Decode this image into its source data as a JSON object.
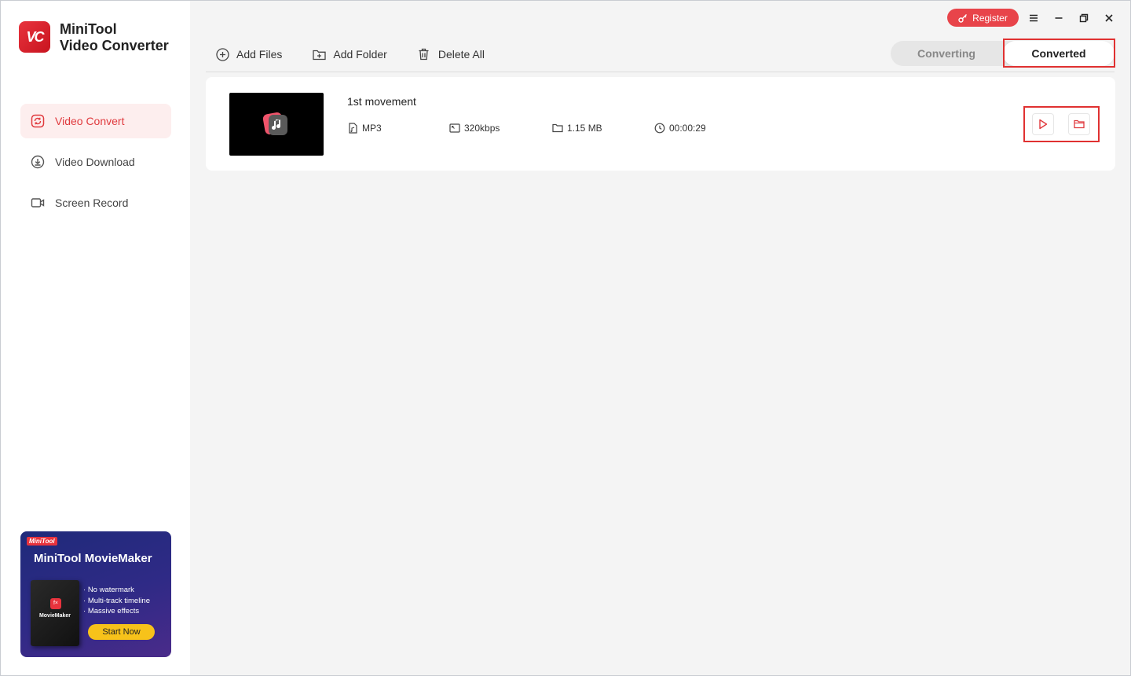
{
  "app": {
    "name_line1": "MiniTool",
    "name_line2": "Video Converter",
    "logo_text": "VC"
  },
  "sidebar": {
    "items": [
      {
        "label": "Video Convert",
        "icon": "convert-icon",
        "active": true
      },
      {
        "label": "Video Download",
        "icon": "download-icon",
        "active": false
      },
      {
        "label": "Screen Record",
        "icon": "camera-icon",
        "active": false
      }
    ]
  },
  "promo": {
    "brand": "MiniTool",
    "title": "MiniTool MovieMaker",
    "box_caption": "MovieMaker",
    "features": [
      "No watermark",
      "Multi-track timeline",
      "Massive effects"
    ],
    "button": "Start Now"
  },
  "header": {
    "register": "Register"
  },
  "toolbar": {
    "add_files": "Add Files",
    "add_folder": "Add Folder",
    "delete_all": "Delete All"
  },
  "tabs": {
    "converting": "Converting",
    "converted": "Converted",
    "active": "converted"
  },
  "files": [
    {
      "title": "1st movement",
      "format": "MP3",
      "bitrate": "320kbps",
      "size": "1.15 MB",
      "duration": "00:00:29"
    }
  ],
  "colors": {
    "accent": "#e03a3e",
    "highlight": "#e03131"
  }
}
